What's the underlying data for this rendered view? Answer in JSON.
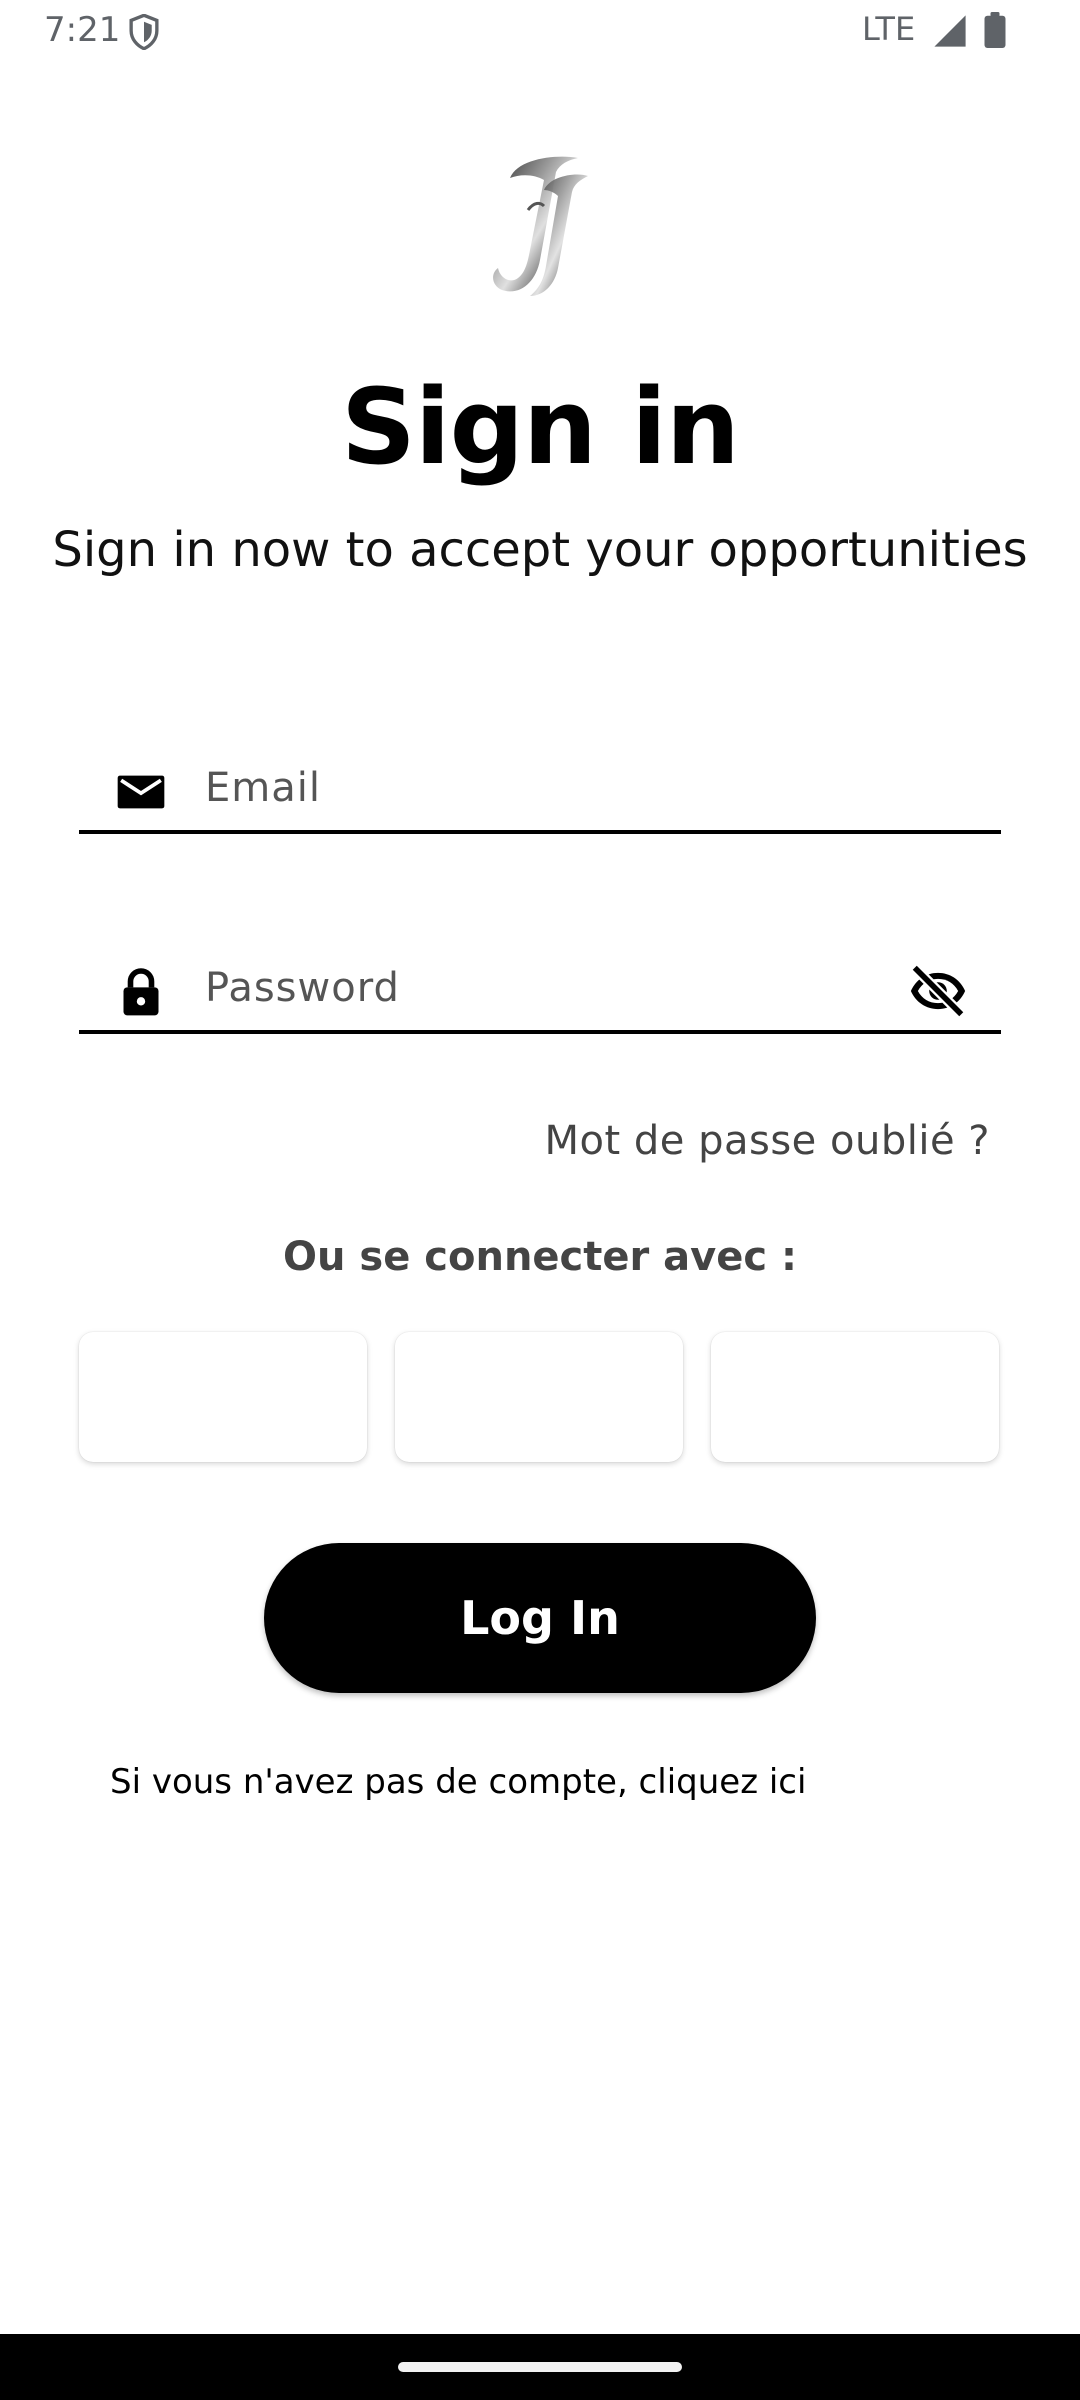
{
  "status_bar": {
    "time": "7:21",
    "network": "LTE",
    "icons": [
      "shield-icon",
      "signal-icon",
      "battery-icon"
    ]
  },
  "logo": {
    "icon": "jj-monogram-logo"
  },
  "header": {
    "title": "Sign in",
    "subtitle": "Sign in now to accept your opportunities"
  },
  "form": {
    "email": {
      "icon": "mail-icon",
      "placeholder": "Email",
      "value": ""
    },
    "password": {
      "icon": "lock-icon",
      "placeholder": "Password",
      "value": "",
      "toggle_icon": "eye-off-icon"
    },
    "forgot_password": "Mot de passe oublié ?"
  },
  "social": {
    "heading": "Ou se connecter avec :",
    "buttons": [
      "",
      "",
      ""
    ]
  },
  "actions": {
    "login_label": "Log In",
    "signup_text": "Si vous n'avez pas de compte, cliquez ici"
  },
  "colors": {
    "primary": "#000000",
    "secondary_text": "#444444",
    "background": "#ffffff"
  }
}
